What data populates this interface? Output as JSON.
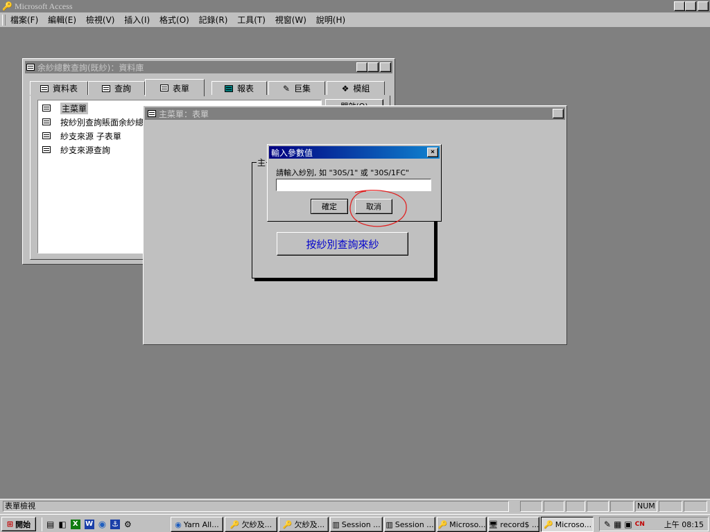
{
  "app": {
    "title": "Microsoft Access",
    "menu": [
      "檔案(F)",
      "編輯(E)",
      "檢視(V)",
      "插入(I)",
      "格式(O)",
      "記錄(R)",
      "工具(T)",
      "視窗(W)",
      "說明(H)"
    ]
  },
  "db_window": {
    "title": "余紗總數查詢(既紗)：資料庫",
    "tabs": [
      "資料表",
      "查詢",
      "表單",
      "報表",
      "巨集",
      "模組"
    ],
    "selected_tab": "表單",
    "items": [
      "主菜單",
      "按紗別查詢賬面余紗總",
      "紗支來源 子表單",
      "紗支來源查詢"
    ],
    "open_button": "開啟(O)"
  },
  "form_window": {
    "title": "主菜單：表單",
    "group_label": "主",
    "button_label": "按紗別查詢來紗"
  },
  "dialog": {
    "title": "輸入參數值",
    "prompt": "請輸入紗別, 如 \"30S/1\" 或 \"30S/1FC\"",
    "input_value": "",
    "ok": "確定",
    "cancel": "取消"
  },
  "annotation": {
    "color": "#e02020"
  },
  "status_bar": {
    "text": "表單檢視",
    "indicators": [
      "",
      "",
      "",
      "",
      "",
      "NUM",
      "",
      ""
    ]
  },
  "taskbar": {
    "start": "開始",
    "items": [
      "Yarn All...",
      "欠紗及...",
      "欠紗及...",
      "Session ...",
      "Session ...",
      "Microso...",
      "record$ ...",
      "Microso..."
    ],
    "clock": "上午 08:15"
  }
}
